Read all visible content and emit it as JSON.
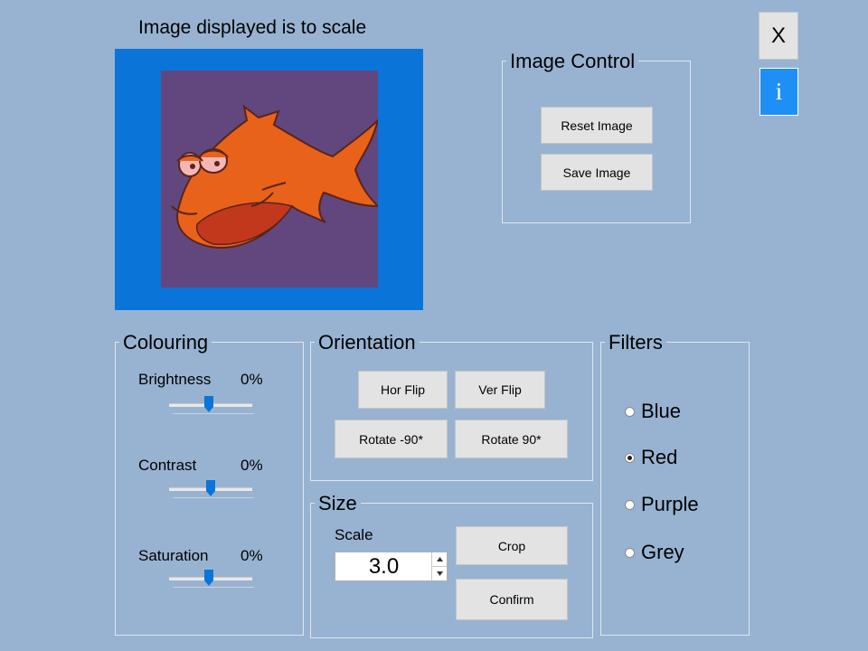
{
  "preview": {
    "caption": "Image displayed is to scale",
    "frame_color": "#0a74d8",
    "canvas_color": "#62477f"
  },
  "window_controls": {
    "close_label": "X",
    "info_label": "i",
    "info_color": "#1e8ff5"
  },
  "image_control": {
    "title": "Image Control",
    "reset_label": "Reset Image",
    "save_label": "Save Image"
  },
  "colouring": {
    "title": "Colouring",
    "sliders": [
      {
        "label": "Brightness",
        "value": "0%"
      },
      {
        "label": "Contrast",
        "value": "0%"
      },
      {
        "label": "Saturation",
        "value": "0%"
      }
    ]
  },
  "orientation": {
    "title": "Orientation",
    "hor_flip": "Hor Flip",
    "ver_flip": "Ver Flip",
    "rotate_neg": "Rotate -90*",
    "rotate_pos": "Rotate 90*"
  },
  "size": {
    "title": "Size",
    "scale_label": "Scale",
    "scale_value": "3.0",
    "crop_label": "Crop",
    "confirm_label": "Confirm"
  },
  "filters": {
    "title": "Filters",
    "options": [
      {
        "label": "Blue",
        "checked": false
      },
      {
        "label": "Red",
        "checked": true
      },
      {
        "label": "Purple",
        "checked": false
      },
      {
        "label": "Grey",
        "checked": false
      }
    ]
  }
}
